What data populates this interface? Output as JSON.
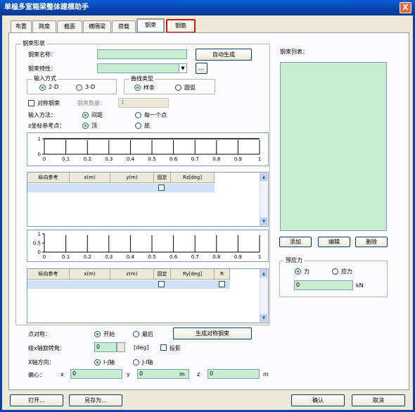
{
  "window": {
    "title": "单榀多室箱梁整体建模助手",
    "close_label": "X"
  },
  "tabs": [
    {
      "label": "布置"
    },
    {
      "label": "跨度"
    },
    {
      "label": "截面"
    },
    {
      "label": "横隔梁"
    },
    {
      "label": "荷载"
    },
    {
      "label": "钢束"
    },
    {
      "label": "钢筋"
    }
  ],
  "steel_group": {
    "title": "钢束形状",
    "name_label": "钢束名称：",
    "name_value": "",
    "auto_button": "自动生成",
    "prop_label": "钢束特性：",
    "prop_value": "",
    "prop_button": "...",
    "input_group": {
      "title": "输入方式",
      "opt1": "2-D",
      "opt2": "3-D"
    },
    "curve_group": {
      "title": "曲线类型",
      "opt1": "样条",
      "opt2": "圆弧"
    },
    "symmetric_label": "对称钢束",
    "count_label": "钢束数量：",
    "count_value": "1",
    "input_method_label": "输入方法：",
    "input_method_opt1": "间距",
    "input_method_opt2": "每一个点",
    "z_ref_label": "z坐标参考点：",
    "z_ref_opt1": "顶",
    "z_ref_opt2": "底"
  },
  "chart_top": {
    "y_ticks": [
      "1",
      "0"
    ],
    "x_ticks": [
      "0",
      "0.1",
      "0.2",
      "0.3",
      "0.4",
      "0.5",
      "0.6",
      "0.7",
      "0.8",
      "0.9",
      "1"
    ]
  },
  "table1": {
    "columns": [
      "纵向参考",
      "x(m)",
      "y(m)",
      "固定",
      "Rz[deg]"
    ]
  },
  "chart_bottom": {
    "y_ticks": [
      "1",
      "0.5",
      "0"
    ],
    "x_ticks": [
      "0",
      "0.1",
      "0.2",
      "0.3",
      "0.4",
      "0.5",
      "0.6",
      "0.7",
      "0.8",
      "0.9",
      "1"
    ]
  },
  "table2": {
    "columns": [
      "纵向参考",
      "x(m)",
      "z(m)",
      "固定",
      "Ry[deg]",
      "R"
    ]
  },
  "bottom": {
    "sym_label": "点对称：",
    "sym_opt1": "开始",
    "sym_opt2": "最后",
    "gen_button": "生成对称钢束",
    "rotate_label": "绕x轴旋转角：",
    "rotate_value": "0",
    "rotate_unit": "[deg]",
    "projection_label": "投影",
    "xdir_label": "X轴方向：",
    "xdir_opt1": "I-J轴",
    "xdir_opt2": "J-I轴",
    "offset_label": "偏心：",
    "x_label": "x",
    "x_value": "0",
    "y_label": "y",
    "y_value": "0",
    "z_label": "z",
    "z_value": "0",
    "unit_m": "m"
  },
  "right": {
    "list_label": "钢束列表：",
    "add": "添加",
    "edit": "编辑",
    "delete": "删除",
    "prestress_title": "预应力",
    "force_label": "力",
    "stress_label": "应力",
    "prestress_value": "0",
    "prestress_unit": "kN"
  },
  "footer": {
    "open": "打开...",
    "save_as": "另存为...",
    "ok": "确认",
    "cancel": "取消"
  }
}
